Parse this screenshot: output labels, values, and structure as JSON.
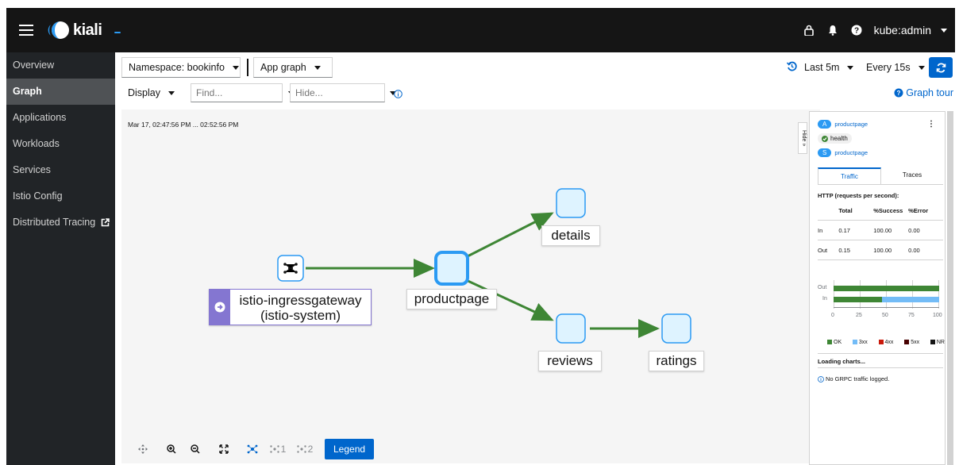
{
  "header": {
    "logo_text": "kiali",
    "user": "kube:admin"
  },
  "sidebar": {
    "items": [
      {
        "label": "Overview"
      },
      {
        "label": "Graph"
      },
      {
        "label": "Applications"
      },
      {
        "label": "Workloads"
      },
      {
        "label": "Services"
      },
      {
        "label": "Istio Config"
      },
      {
        "label": "Distributed Tracing"
      }
    ]
  },
  "toolbar": {
    "namespace": "Namespace: bookinfo",
    "graph_type": "App graph",
    "time_range": "Last 5m",
    "refresh": "Every 15s",
    "display": "Display",
    "find_placeholder": "Find...",
    "hide_placeholder": "Hide...",
    "graph_tour": "Graph tour"
  },
  "graph": {
    "timestamp": "Mar 17, 02:47:56 PM ... 02:52:56 PM",
    "gateway_line1": "istio-ingressgateway",
    "gateway_line2": "(istio-system)",
    "nodes": {
      "productpage": "productpage",
      "details": "details",
      "reviews": "reviews",
      "ratings": "ratings"
    },
    "controls": {
      "legend": "Legend",
      "layout1": "1",
      "layout2": "2"
    },
    "edge_color": "#3e8635",
    "node_border": "#2b9af3",
    "node_fill": "#def3ff"
  },
  "side_panel": {
    "hide": "Hide",
    "app_badge": "A",
    "app_name": "productpage",
    "health": "health",
    "svc_badge": "S",
    "svc_name": "productpage",
    "tabs": [
      "Traffic",
      "Traces"
    ],
    "http_title": "HTTP (requests per second):",
    "table": {
      "headers": [
        "",
        "Total",
        "%Success",
        "%Error"
      ],
      "rows": [
        [
          "In",
          "0.17",
          "100.00",
          "0.00"
        ],
        [
          "Out",
          "0.15",
          "100.00",
          "0.00"
        ]
      ]
    },
    "chart_out_label": "Out",
    "chart_in_label": "In",
    "chart_ticks": [
      "0",
      "25",
      "50",
      "75",
      "100"
    ],
    "chart_out_ok_pct": 100,
    "chart_in_ok_pct": 46,
    "chart_in_3xx_pct": 54,
    "legend": [
      {
        "label": "OK",
        "color": "#3e8635"
      },
      {
        "label": "3xx",
        "color": "#73bcf7"
      },
      {
        "label": "4xx",
        "color": "#c9190b"
      },
      {
        "label": "5xx",
        "color": "#470000"
      },
      {
        "label": "NR",
        "color": "#151515"
      }
    ],
    "loading": "Loading charts...",
    "grpc": "No GRPC traffic logged."
  }
}
